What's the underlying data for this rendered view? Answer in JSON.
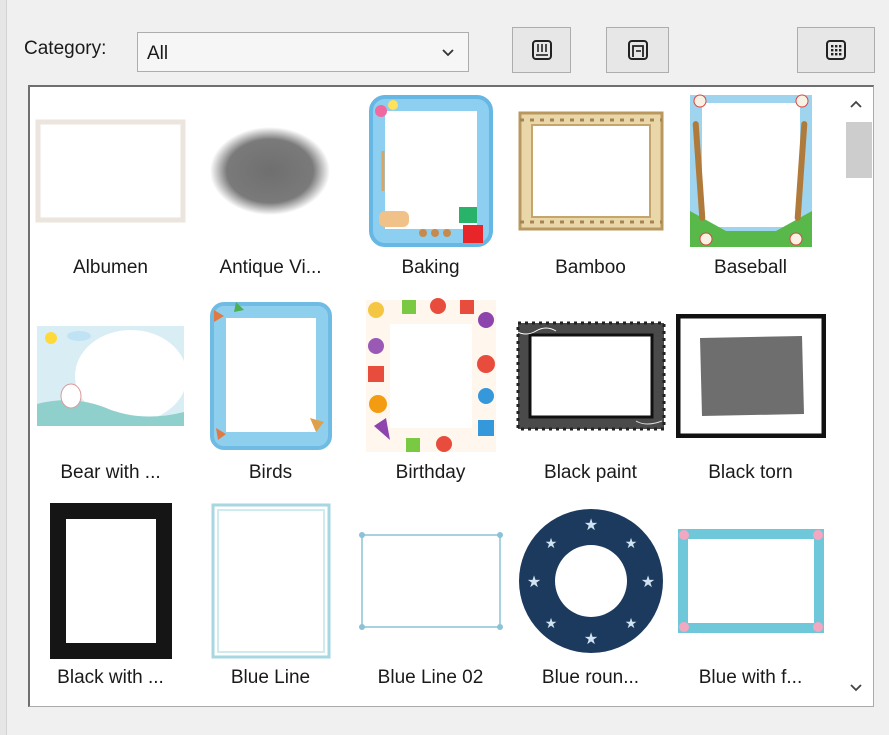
{
  "category": {
    "label": "Category:",
    "selected": "All"
  },
  "toolbar": [
    {
      "name": "toolbar-button-1",
      "icon": "frame-top-icon"
    },
    {
      "name": "toolbar-button-2",
      "icon": "frame-inset-icon"
    },
    {
      "name": "toolbar-button-3",
      "icon": "grid-view-icon"
    }
  ],
  "frames": [
    {
      "label": "Albumen",
      "icon": "albumen-frame-thumbnail"
    },
    {
      "label": "Antique Vi...",
      "icon": "antique-vignette-frame-thumbnail"
    },
    {
      "label": "Baking",
      "icon": "baking-frame-thumbnail"
    },
    {
      "label": "Bamboo",
      "icon": "bamboo-frame-thumbnail"
    },
    {
      "label": "Baseball",
      "icon": "baseball-frame-thumbnail"
    },
    {
      "label": "Bear with ...",
      "icon": "bear-frame-thumbnail"
    },
    {
      "label": "Birds",
      "icon": "birds-frame-thumbnail"
    },
    {
      "label": "Birthday",
      "icon": "birthday-frame-thumbnail"
    },
    {
      "label": "Black paint",
      "icon": "black-paint-frame-thumbnail"
    },
    {
      "label": "Black torn",
      "icon": "black-torn-frame-thumbnail"
    },
    {
      "label": "Black with ...",
      "icon": "black-with-frame-thumbnail"
    },
    {
      "label": "Blue Line",
      "icon": "blue-line-frame-thumbnail"
    },
    {
      "label": "Blue Line 02",
      "icon": "blue-line-02-frame-thumbnail"
    },
    {
      "label": "Blue roun...",
      "icon": "blue-round-frame-thumbnail"
    },
    {
      "label": "Blue with f...",
      "icon": "blue-with-flowers-frame-thumbnail"
    }
  ]
}
